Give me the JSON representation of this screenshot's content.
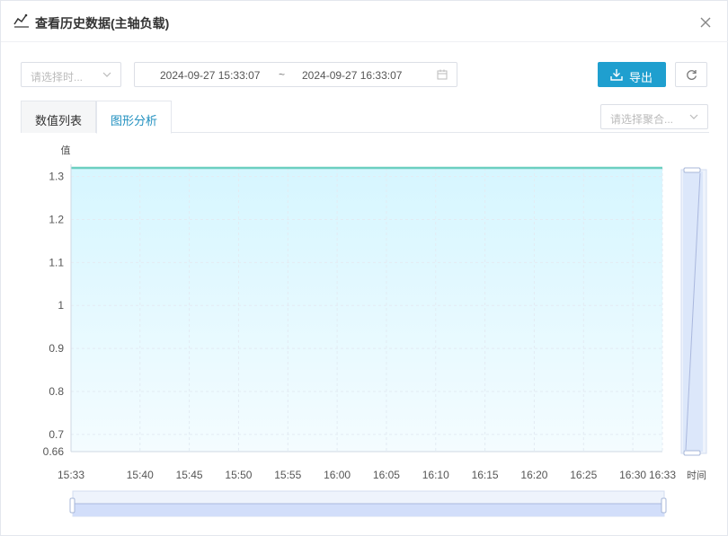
{
  "header": {
    "title": "查看历史数据(主轴负载)",
    "title_icon": "line-chart-icon",
    "close_icon": "close-icon"
  },
  "toolbar": {
    "time_select_placeholder": "请选择时...",
    "date_start": "2024-09-27 15:33:07",
    "date_separator": "~",
    "date_end": "2024-09-27 16:33:07",
    "export_label": "导出",
    "aggregation_placeholder": "请选择聚合..."
  },
  "tabs": [
    {
      "label": "数值列表",
      "active": false
    },
    {
      "label": "图形分析",
      "active": true
    }
  ],
  "colors": {
    "accent": "#1f9fcf",
    "series_line": "#6ccfc0",
    "area_top": "#d6f6ff",
    "area_bottom": "#f4fcff"
  },
  "chart_data": {
    "type": "area",
    "ylabel": "值",
    "xlabel": "时间",
    "ylim": [
      0.66,
      1.32
    ],
    "y_ticks": [
      0.66,
      0.7,
      0.8,
      0.9,
      1,
      1.1,
      1.2,
      1.3
    ],
    "y_tick_labels": [
      "0.66",
      "0.7",
      "0.8",
      "0.9",
      "1",
      "1.1",
      "1.2",
      "1.3"
    ],
    "x_tick_labels": [
      "15:33",
      "15:40",
      "15:45",
      "15:50",
      "15:55",
      "16:00",
      "16:05",
      "16:10",
      "16:15",
      "16:20",
      "16:25",
      "16:30",
      "16:33"
    ],
    "x_tick_minutes": [
      0,
      7,
      12,
      17,
      22,
      27,
      32,
      37,
      42,
      47,
      52,
      57,
      60
    ],
    "series": [
      {
        "x": [
          "15:33",
          "16:33"
        ],
        "values": [
          1.32,
          1.32
        ]
      }
    ],
    "grid": true,
    "x_zoom_range": [
      0,
      100
    ],
    "y_zoom_range": [
      0,
      100
    ]
  }
}
